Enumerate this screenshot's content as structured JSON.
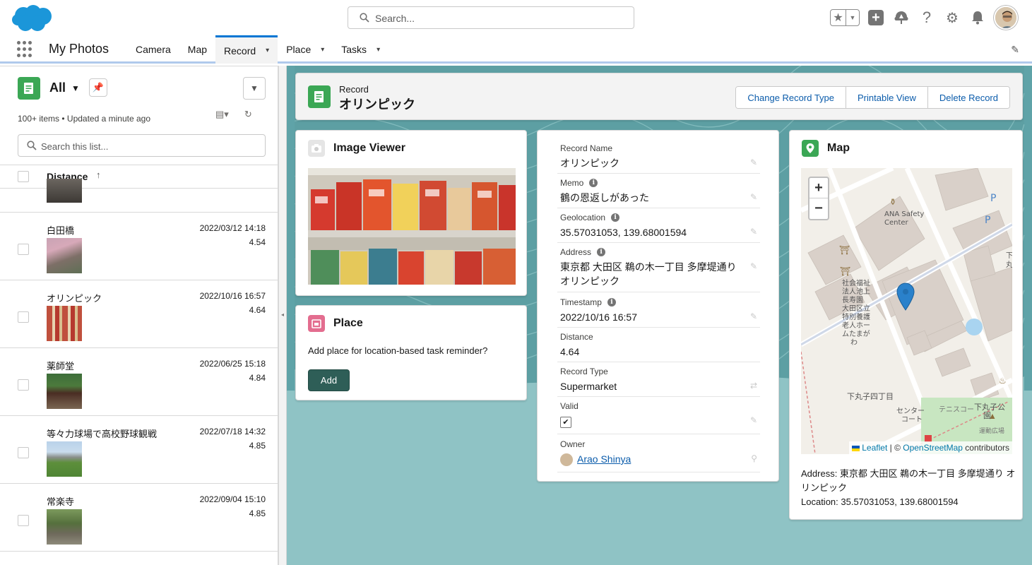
{
  "header": {
    "search_placeholder": "Search...",
    "icons": [
      "favorites-star-icon",
      "add-icon",
      "trailhead-icon",
      "help-icon",
      "setup-gear-icon",
      "notifications-bell-icon",
      "user-avatar"
    ]
  },
  "nav": {
    "app_name": "My Photos",
    "items": [
      {
        "label": "Camera",
        "has_menu": false
      },
      {
        "label": "Map",
        "has_menu": false
      },
      {
        "label": "Record",
        "has_menu": true,
        "active": true
      },
      {
        "label": "Place",
        "has_menu": true
      },
      {
        "label": "Tasks",
        "has_menu": true
      }
    ]
  },
  "list": {
    "view_name": "All",
    "meta": "100+ items • Updated a minute ago",
    "search_placeholder": "Search this list...",
    "sort_column": "Distance",
    "rows": [
      {
        "name": "白田橋",
        "timestamp": "2022/03/12 14:18",
        "distance": "4.54"
      },
      {
        "name": "オリンピック",
        "timestamp": "2022/10/16 16:57",
        "distance": "4.64"
      },
      {
        "name": "薬師堂",
        "timestamp": "2022/06/25 15:18",
        "distance": "4.84"
      },
      {
        "name": "等々力球場で高校野球観戦",
        "timestamp": "2022/07/18 14:32",
        "distance": "4.85"
      },
      {
        "name": "常楽寺",
        "timestamp": "2022/09/04 15:10",
        "distance": "4.85"
      }
    ]
  },
  "record": {
    "object_label": "Record",
    "name": "オリンピック",
    "actions": [
      "Change Record Type",
      "Printable View",
      "Delete Record"
    ]
  },
  "image_viewer": {
    "title": "Image Viewer"
  },
  "place": {
    "title": "Place",
    "description": "Add place for location-based task reminder?",
    "add_label": "Add"
  },
  "details": {
    "fields": [
      {
        "label": "Record Name",
        "value": "オリンピック",
        "info": false
      },
      {
        "label": "Memo",
        "value": "鶴の恩返しがあった",
        "info": true
      },
      {
        "label": "Geolocation",
        "value": "35.57031053, 139.68001594",
        "info": true
      },
      {
        "label": "Address",
        "value": "東京都 大田区 鵜の木一丁目 多摩堤通り オリンピック",
        "info": true
      },
      {
        "label": "Timestamp",
        "value": "2022/10/16 16:57",
        "info": true
      },
      {
        "label": "Distance",
        "value": "4.64",
        "info": false
      },
      {
        "label": "Record Type",
        "value": "Supermarket",
        "info": false
      },
      {
        "label": "Valid",
        "value": "✔",
        "info": false
      },
      {
        "label": "Owner",
        "value": "Arao Shinya",
        "info": false
      }
    ]
  },
  "map": {
    "title": "Map",
    "zoom_in": "+",
    "zoom_out": "−",
    "attribution_leaflet": "Leaflet",
    "attribution_sep": " | © ",
    "attribution_osm": "OpenStreetMap",
    "attribution_tail": " contributors",
    "labels": {
      "ana": "ANA Safety\nCenter",
      "home": "社会福祉\n法人池上\n長寿園\n大田区立\n特別養護\n老人ホー\nムたまが\nわ",
      "shimo": "下丸子四丁目",
      "center": "センター\nコート",
      "tennis": "テニスコー",
      "park": "下丸子公\n園",
      "sports": "運動広場",
      "shimo_r": "下\n丸"
    },
    "address_line": "Address: 東京都 大田区 鵜の木一丁目 多摩堤通り オリンピック",
    "location_line": "Location: 35.57031053, 139.68001594"
  }
}
